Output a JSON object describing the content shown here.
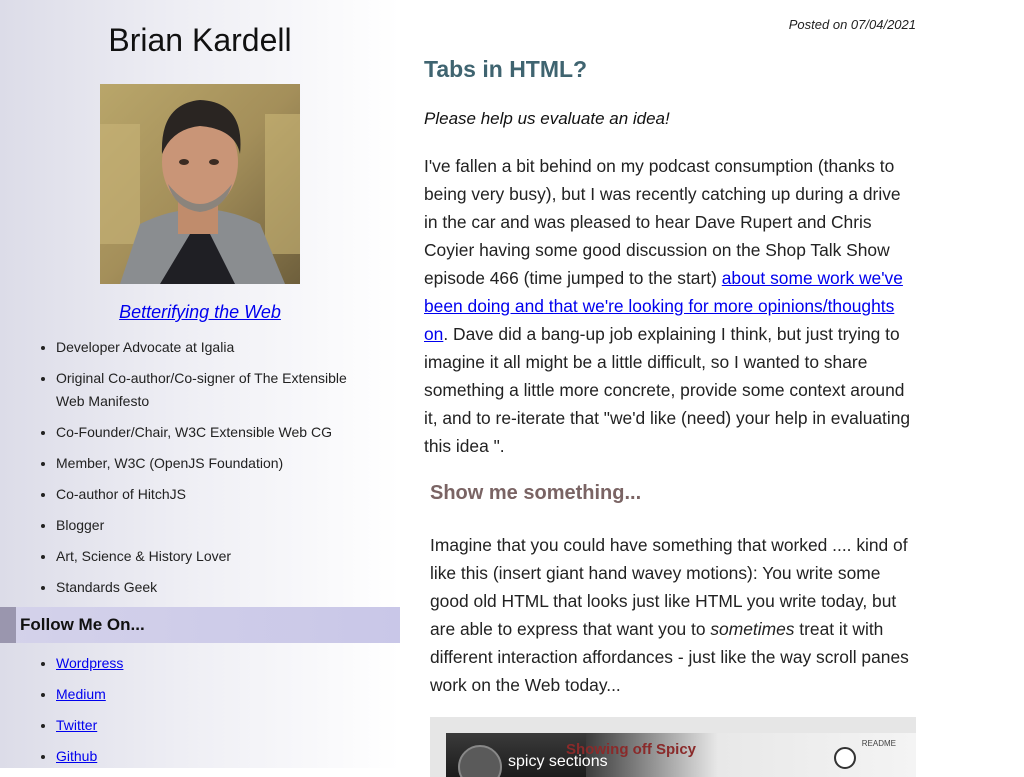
{
  "sidebar": {
    "site_title": "Brian Kardell",
    "tagline": "Betterifying the Web",
    "bio_items": [
      "Developer Advocate at Igalia",
      "Original Co-author/Co-signer of The Extensible Web Manifesto",
      "Co-Founder/Chair, W3C Extensible Web CG",
      "Member, W3C (OpenJS Foundation)",
      "Co-author of HitchJS",
      "Blogger",
      "Art, Science & History Lover",
      "Standards Geek"
    ],
    "follow_heading": "Follow Me On...",
    "social_links": [
      "Wordpress",
      "Medium",
      "Twitter",
      "Github"
    ]
  },
  "post": {
    "posted": "Posted on 07/04/2021",
    "title": "Tabs in HTML?",
    "intro": "Please help us evaluate an idea!",
    "para1_before": "I've fallen a bit behind on my podcast consumption (thanks to being very busy), but I was recently catching up during a drive in the car and was pleased to hear Dave Rupert and Chris Coyier having some good discussion on the Shop Talk Show episode 466 (time jumped to the start) ",
    "para1_link": "about some work we've been doing and that we're looking for more opinions/thoughts on",
    "para1_after": ". Dave did a bang-up job explaining I think, but just trying to imagine it all might be a little difficult, so I wanted to share something a little more concrete, provide some context around it, and to re-iterate that \"we'd like (need) your help in evaluating this idea \".",
    "subhead": "Show me something...",
    "para2_before": "Imagine that you could have something that worked .... kind of like this (insert giant hand wavey motions): You write some good old HTML that looks just like HTML you write today, but are able to express that want you to ",
    "para2_em": "sometimes",
    "para2_after": " treat it with different interaction affordances - just like the way scroll panes work on the Web today...",
    "video": {
      "name": "spicy sections",
      "slide_title": "Showing off Spicy",
      "small_text": "README"
    }
  }
}
